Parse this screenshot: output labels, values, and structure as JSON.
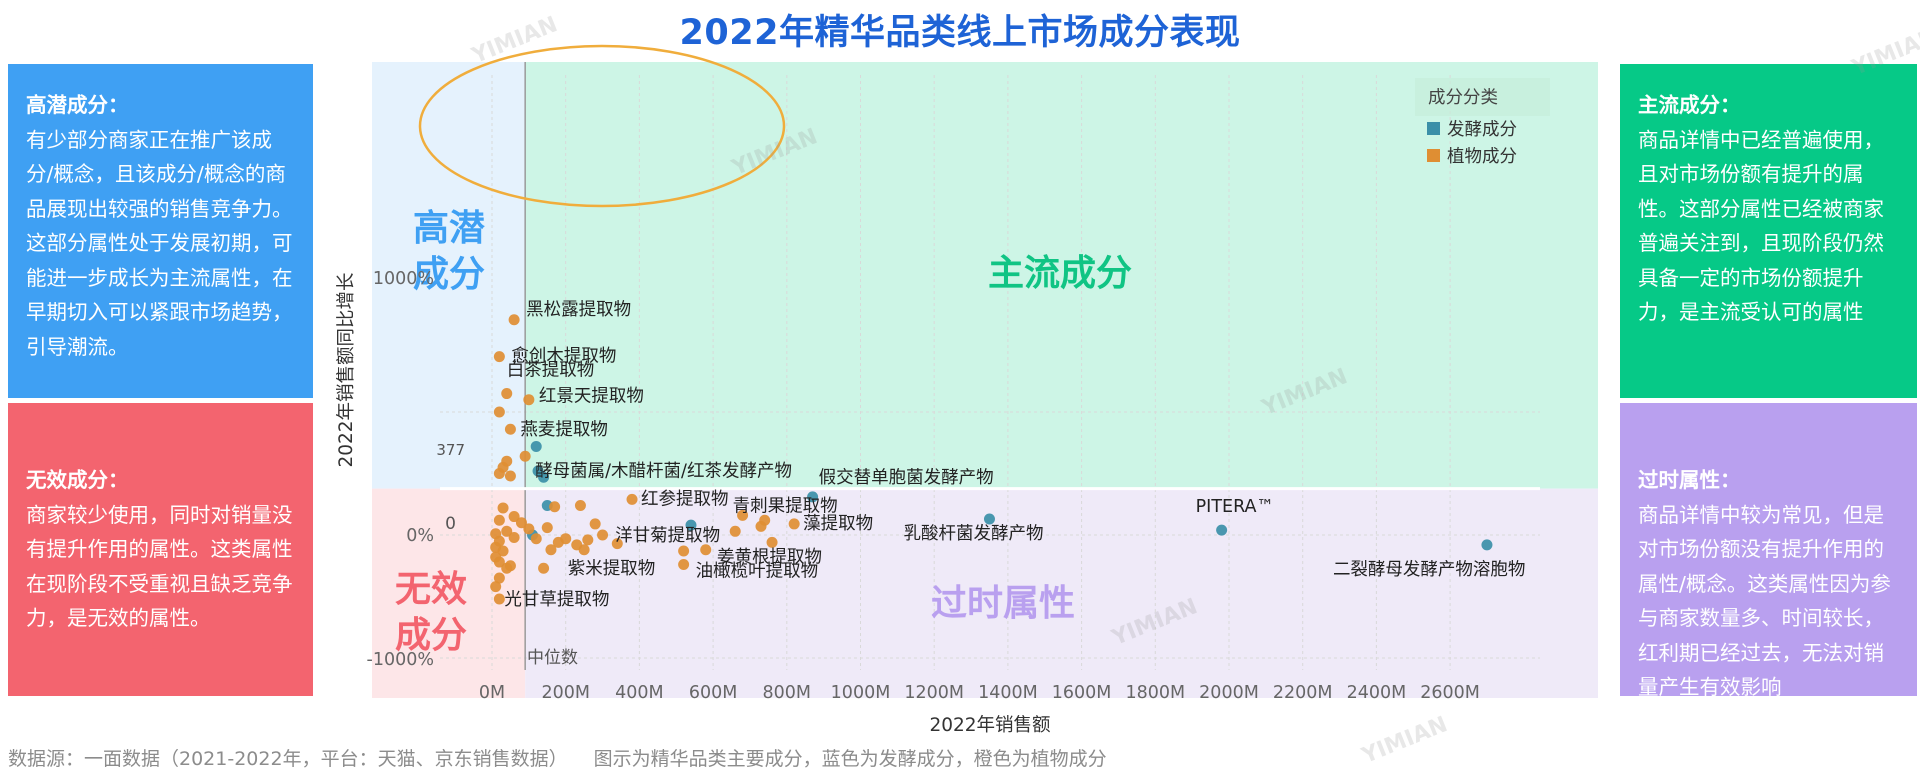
{
  "chart_data": {
    "type": "scatter",
    "title": "2022年精华品类线上市场成分表现",
    "xlabel": "2022年销售额",
    "ylabel": "2022年销售额同比增长",
    "x_ticks": [
      "0M",
      "200M",
      "400M",
      "600M",
      "800M",
      "1000M",
      "1200M",
      "1400M",
      "1600M",
      "1800M",
      "2000M",
      "2200M",
      "2400M",
      "2600M"
    ],
    "y_ticks": [
      "1000%",
      "0%",
      "-1000%"
    ],
    "xlim": [
      -30,
      2830
    ],
    "ylim": [
      -1090,
      1850
    ],
    "median_x": 90,
    "median_y": 377,
    "median_x_label": "中位数",
    "median_y_label": "377",
    "zero_label": "0",
    "grid": true,
    "legend_title": "成分分类",
    "legend_position": "top-right",
    "series": [
      {
        "name": "发酵成分",
        "color": "#3b8fa8",
        "points": [
          {
            "x": 120,
            "y": 720
          },
          {
            "x": 125,
            "y": 520
          },
          {
            "x": 140,
            "y": 470
          },
          {
            "x": 150,
            "y": 240
          },
          {
            "x": 110,
            "y": 0
          },
          {
            "x": 540,
            "y": 80
          },
          {
            "x": 870,
            "y": 310,
            "label": "假交替单胞菌发酵产物"
          },
          {
            "x": 1350,
            "y": 130,
            "label": "乳酸杆菌发酵产物"
          },
          {
            "x": 1980,
            "y": 40,
            "label": "PITERA™"
          },
          {
            "x": 2700,
            "y": -80,
            "label": "二裂酵母发酵产物溶胞物"
          }
        ]
      },
      {
        "name": "植物成分",
        "color": "#df8e33",
        "points": [
          {
            "x": 60,
            "y": 1750,
            "label": "黑松露提取物"
          },
          {
            "x": 20,
            "y": 1450,
            "label": "愈创木提取物"
          },
          {
            "x": 40,
            "y": 1150,
            "label": "白茶提取物"
          },
          {
            "x": 100,
            "y": 1100,
            "label": "红景天提取物"
          },
          {
            "x": 20,
            "y": 1000
          },
          {
            "x": 50,
            "y": 860,
            "label": "燕麦提取物"
          },
          {
            "x": 90,
            "y": 640,
            "label": "酵母菌属/木醋杆菌/红茶发酵产物"
          },
          {
            "x": 40,
            "y": 600
          },
          {
            "x": 30,
            "y": 550
          },
          {
            "x": 20,
            "y": 500
          },
          {
            "x": 50,
            "y": 480
          },
          {
            "x": 30,
            "y": 220
          },
          {
            "x": 60,
            "y": 150
          },
          {
            "x": 20,
            "y": 120
          },
          {
            "x": 80,
            "y": 100
          },
          {
            "x": 100,
            "y": 50
          },
          {
            "x": 40,
            "y": 30
          },
          {
            "x": 10,
            "y": 10
          },
          {
            "x": 60,
            "y": -20
          },
          {
            "x": 20,
            "y": -50
          },
          {
            "x": 120,
            "y": -30
          },
          {
            "x": 150,
            "y": 60
          },
          {
            "x": 170,
            "y": 230
          },
          {
            "x": 240,
            "y": 240
          },
          {
            "x": 180,
            "y": -60
          },
          {
            "x": 200,
            "y": -30
          },
          {
            "x": 230,
            "y": -80
          },
          {
            "x": 160,
            "y": -120
          },
          {
            "x": 260,
            "y": -40
          },
          {
            "x": 300,
            "y": 0
          },
          {
            "x": 340,
            "y": -70
          },
          {
            "x": 280,
            "y": 90,
            "label": "洋甘菊提取物"
          },
          {
            "x": 380,
            "y": 290,
            "label": "红参提取物"
          },
          {
            "x": 10,
            "y": -100
          },
          {
            "x": 30,
            "y": -130
          },
          {
            "x": 10,
            "y": -180
          },
          {
            "x": 20,
            "y": -220
          },
          {
            "x": 50,
            "y": -250
          },
          {
            "x": 40,
            "y": -270,
            "label": "紫米提取物"
          },
          {
            "x": 20,
            "y": -350
          },
          {
            "x": 10,
            "y": -420
          },
          {
            "x": 20,
            "y": -520,
            "label": "光甘草提取物"
          },
          {
            "x": 140,
            "y": -270
          },
          {
            "x": 250,
            "y": -120
          },
          {
            "x": 520,
            "y": -130
          },
          {
            "x": 580,
            "y": -120
          },
          {
            "x": 520,
            "y": -240,
            "label": "油橄榄叶提取物"
          },
          {
            "x": 680,
            "y": 160,
            "label": "青刺果提取物"
          },
          {
            "x": 660,
            "y": 30
          },
          {
            "x": 730,
            "y": 70
          },
          {
            "x": 740,
            "y": 120
          },
          {
            "x": 820,
            "y": 90,
            "label": "藻提取物"
          },
          {
            "x": 760,
            "y": -60,
            "label": "姜黄根提取物"
          }
        ]
      }
    ],
    "quadrant_labels": {
      "high_potential": "高潜\n成分",
      "mainstream": "主流成分",
      "invalid": "无效\n成分",
      "outdated": "过时属性"
    }
  },
  "boxes": {
    "high_potential": {
      "title": "高潜成分：",
      "text": "有少部分商家正在推广该成分/概念，且该成分/概念的商品展现出较强的销售竞争力。这部分属性处于发展初期，可能进一步成长为主流属性，在早期切入可以紧跟市场趋势，引导潮流。"
    },
    "invalid": {
      "title": "无效成分：",
      "text": "商家较少使用，同时对销量没有提升作用的属性。这类属性在现阶段不受重视且缺乏竞争力，是无效的属性。"
    },
    "mainstream": {
      "title": "主流成分：",
      "text": "商品详情中已经普遍使用，且对市场份额有提升的属性。这部分属性已经被商家普遍关注到，且现阶段仍然具备一定的市场份额提升力，是主流受认可的属性"
    },
    "outdated": {
      "title": "过时属性：",
      "text": "商品详情中较为常见，但是对市场份额没有提升作用的属性/概念。这类属性因为参与商家数量多、时间较长，红利期已经过去，无法对销量产生有效影响"
    }
  },
  "footer": {
    "source": "数据源：一面数据（2021-2022年，平台：天猫、京东销售数据）",
    "note": "图示为精华品类主要成分，蓝色为发酵成分，橙色为植物成分"
  },
  "watermark": "YIMIAN",
  "colors": {
    "title": "#1e63d6",
    "high_bg": "#e5f2fd",
    "main_bg": "#cdf5e6",
    "invalid_bg": "#fde6e8",
    "old_bg": "#efeaf8",
    "high_text": "#3fa0f3",
    "main_text": "#10c484",
    "invalid_text": "#f3646f",
    "old_text": "#b9a0ef",
    "highlight_ring": "#f0ad3c"
  }
}
